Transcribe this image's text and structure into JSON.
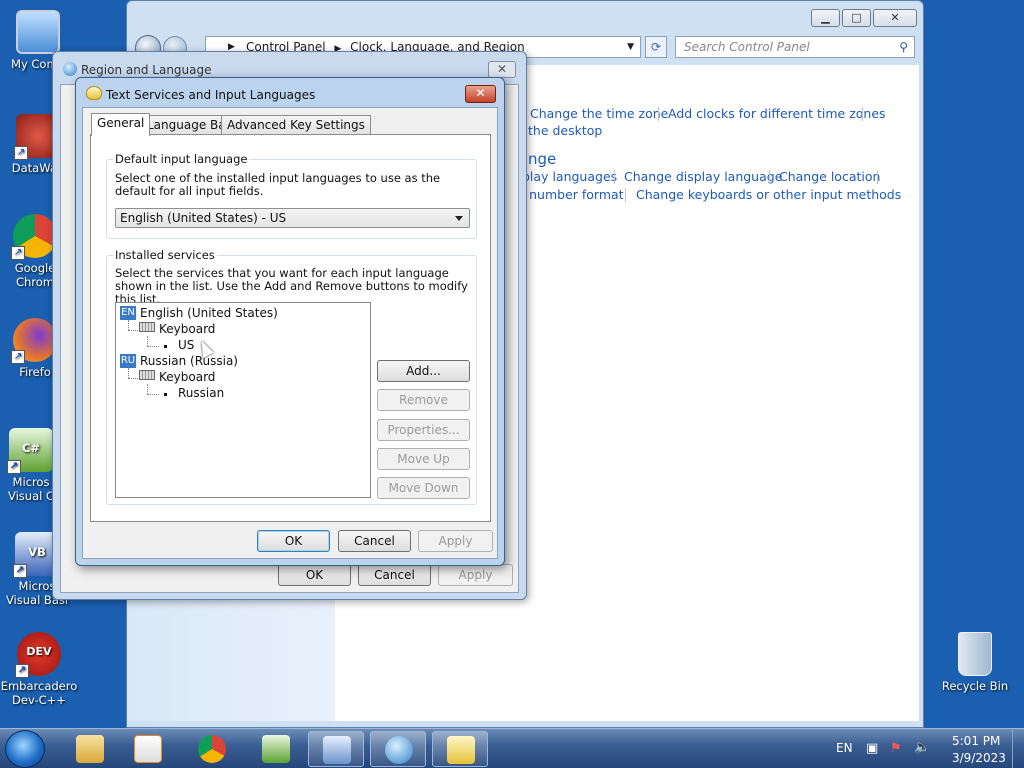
{
  "desktop": {
    "icons": [
      {
        "label": "My Comp",
        "color": "#4a8fd8"
      },
      {
        "label": "DataWag",
        "color": "#c0362c"
      },
      {
        "label": "Google Chrom",
        "color": "#2e9e4f"
      },
      {
        "label": "Firefo",
        "color": "#e8752a"
      },
      {
        "label": "Micros Visual C",
        "color": "#5da232"
      },
      {
        "label": "Micros Visual Basi",
        "color": "#3a64b8"
      },
      {
        "label": "Embarcadero Dev-C++",
        "color": "#c82020"
      }
    ],
    "recycle_bin": "Recycle Bin"
  },
  "control_panel": {
    "address": {
      "root": "Control Panel",
      "current": "Clock, Language, and Region"
    },
    "search_placeholder": "Search Control Panel",
    "links": {
      "change_time_zone": "Change the time zone",
      "add_clocks": "Add clocks for different time zones",
      "desktop": "the desktop",
      "heading_partial": "nge",
      "display_languages": "play languages",
      "change_display_language": "Change display language",
      "change_location": "Change location",
      "number_format": "r number format",
      "change_keyboards": "Change keyboards or other input methods"
    }
  },
  "region_dialog": {
    "title": "Region and Language",
    "ok": "OK",
    "cancel": "Cancel",
    "apply": "Apply"
  },
  "text_services": {
    "title": "Text Services and Input Languages",
    "tabs": [
      "General",
      "Language Bar",
      "Advanced Key Settings"
    ],
    "default_group": {
      "caption": "Default input language",
      "description": "Select one of the installed input languages to use as the default for all input fields.",
      "selected": "English (United States) - US"
    },
    "installed_group": {
      "caption": "Installed services",
      "description": "Select the services that you want for each input language shown in the list. Use the Add and Remove buttons to modify this list.",
      "tree": [
        {
          "code": "EN",
          "language": "English (United States)",
          "category": "Keyboard",
          "layout": "US"
        },
        {
          "code": "RU",
          "language": "Russian (Russia)",
          "category": "Keyboard",
          "layout": "Russian"
        }
      ],
      "buttons": {
        "add": "Add...",
        "remove": "Remove",
        "properties": "Properties...",
        "move_up": "Move Up",
        "move_down": "Move Down"
      }
    },
    "ok": "OK",
    "cancel": "Cancel",
    "apply": "Apply"
  },
  "taskbar": {
    "language": "EN",
    "time": "5:01 PM",
    "date": "3/9/2023"
  }
}
